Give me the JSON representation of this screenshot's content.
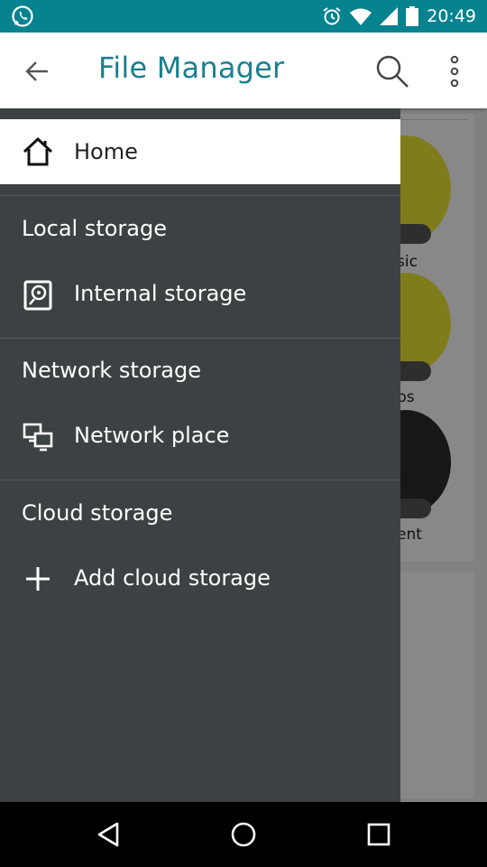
{
  "status_bar": {
    "time": "20:49",
    "icons": [
      "whatsapp-icon",
      "alarm-icon",
      "wifi-icon",
      "signal-icon",
      "battery-icon"
    ]
  },
  "app_bar": {
    "title": "File Manager",
    "icons": [
      "back-arrow-icon",
      "search-icon",
      "more-vert-icon"
    ]
  },
  "background_categories": [
    "sic",
    "ps",
    "ent"
  ],
  "drawer": {
    "home_label": "Home",
    "sections": [
      {
        "title": "Local storage",
        "items": [
          {
            "label": "Internal storage",
            "icon": "storage-icon"
          }
        ]
      },
      {
        "title": "Network storage",
        "items": [
          {
            "label": "Network place",
            "icon": "network-icon"
          }
        ]
      },
      {
        "title": "Cloud storage",
        "items": [
          {
            "label": "Add cloud storage",
            "icon": "add-icon"
          }
        ]
      }
    ]
  },
  "nav_bar": {
    "icons": [
      "nav-back-icon",
      "nav-home-icon",
      "nav-recents-icon"
    ]
  },
  "colors": {
    "status_bar": "#06838f",
    "title": "#1a7f8f",
    "drawer_bg": "#3c4143",
    "accent_circle": "#e7e233"
  }
}
